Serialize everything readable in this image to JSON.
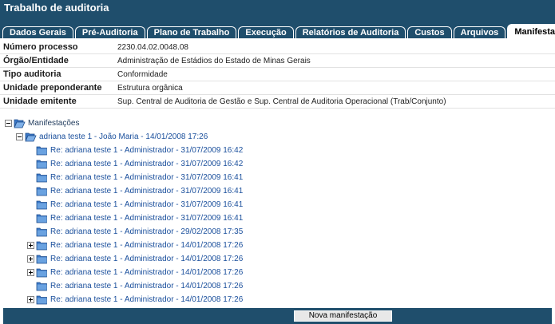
{
  "window": {
    "title": "Trabalho de auditoria"
  },
  "tabs": [
    {
      "label": "Dados Gerais",
      "active": false
    },
    {
      "label": "Pré-Auditoria",
      "active": false
    },
    {
      "label": "Plano de Trabalho",
      "active": false
    },
    {
      "label": "Execução",
      "active": false
    },
    {
      "label": "Relatórios de Auditoria",
      "active": false
    },
    {
      "label": "Custos",
      "active": false
    },
    {
      "label": "Arquivos",
      "active": false
    },
    {
      "label": "Manifestações",
      "active": true
    }
  ],
  "info": [
    {
      "label": "Número processo",
      "value": "2230.04.02.0048.08"
    },
    {
      "label": "Órgão/Entidade",
      "value": "Administração de Estádios do Estado de Minas Gerais"
    },
    {
      "label": "Tipo auditoria",
      "value": "Conformidade"
    },
    {
      "label": "Unidade preponderante",
      "value": "Estrutura orgânica"
    },
    {
      "label": "Unidade emitente",
      "value": "Sup. Central de Auditoria de Gestão e Sup. Central de Auditoria Operacional (Trab/Conjunto)"
    }
  ],
  "tree": {
    "root": {
      "label": "Manifestações",
      "expanded": true
    },
    "parent": {
      "label": "adriana teste 1 - João Maria - 14/01/2008 17:26",
      "expanded": true
    },
    "children": [
      {
        "label": "Re: adriana teste 1 - Administrador - 31/07/2009 16:42",
        "expandable": false
      },
      {
        "label": "Re: adriana teste 1 - Administrador - 31/07/2009 16:42",
        "expandable": false
      },
      {
        "label": "Re: adriana teste 1 - Administrador - 31/07/2009 16:41",
        "expandable": false
      },
      {
        "label": "Re: adriana teste 1 - Administrador - 31/07/2009 16:41",
        "expandable": false
      },
      {
        "label": "Re: adriana teste 1 - Administrador - 31/07/2009 16:41",
        "expandable": false
      },
      {
        "label": "Re: adriana teste 1 - Administrador - 31/07/2009 16:41",
        "expandable": false
      },
      {
        "label": "Re: adriana teste 1 - Administrador - 29/02/2008 17:35",
        "expandable": false
      },
      {
        "label": "Re: adriana teste 1 - Administrador - 14/01/2008 17:26",
        "expandable": true
      },
      {
        "label": "Re: adriana teste 1 - Administrador - 14/01/2008 17:26",
        "expandable": true
      },
      {
        "label": "Re: adriana teste 1 - Administrador - 14/01/2008 17:26",
        "expandable": true
      },
      {
        "label": "Re: adriana teste 1 - Administrador - 14/01/2008 17:26",
        "expandable": false
      },
      {
        "label": "Re: adriana teste 1 - Administrador - 14/01/2008 17:26",
        "expandable": true
      }
    ]
  },
  "footer": {
    "new_button_label": "Nova manifestação"
  },
  "colors": {
    "header": "#1f4e6c",
    "link": "#1a4f9c",
    "folder": "#3b78c8"
  },
  "icons": {
    "folder": "folder-icon",
    "expand": "plus-expander-icon",
    "collapse": "minus-expander-icon"
  }
}
